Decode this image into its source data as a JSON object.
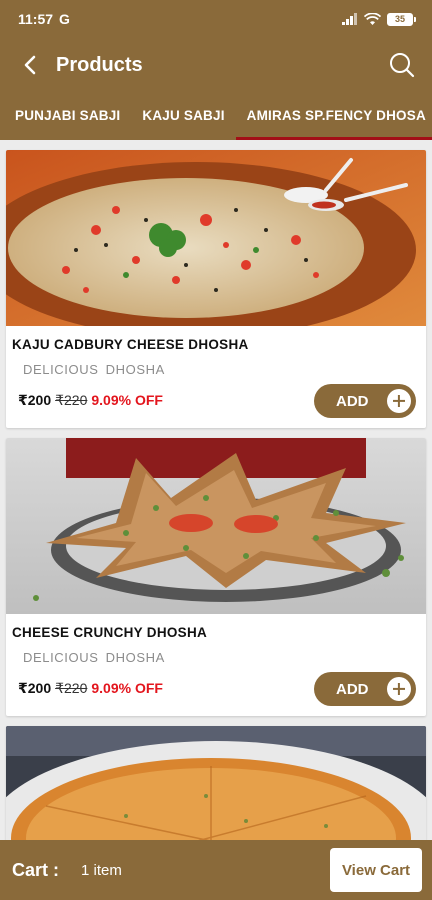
{
  "status_bar": {
    "time": "11:57",
    "carrier_icon": "G",
    "battery": "35"
  },
  "header": {
    "title": "Products",
    "back_icon": "chevron-left-icon",
    "search_icon": "search-icon"
  },
  "tabs": [
    {
      "label": "PUNJABI SABJI",
      "active": false
    },
    {
      "label": "KAJU SABJI",
      "active": false
    },
    {
      "label": "AMIRAS SP.FENCY DHOSA",
      "active": true
    }
  ],
  "products": [
    {
      "name": "KAJU CADBURY CHEESE DHOSHA",
      "category": "DELICIOUS DHOSHA",
      "price": "₹200",
      "mrp": "₹220",
      "discount": "9.09% OFF",
      "add_label": "ADD"
    },
    {
      "name": "CHEESE CRUNCHY DHOSHA",
      "category": "DELICIOUS DHOSHA",
      "price": "₹200",
      "mrp": "₹220",
      "discount": "9.09% OFF",
      "add_label": "ADD"
    }
  ],
  "cart": {
    "label": "Cart :",
    "count": "1 item",
    "button": "View Cart"
  },
  "colors": {
    "brand": "#8a6a3a",
    "discount": "#e3151d",
    "tab_indicator": "#a30f17"
  }
}
